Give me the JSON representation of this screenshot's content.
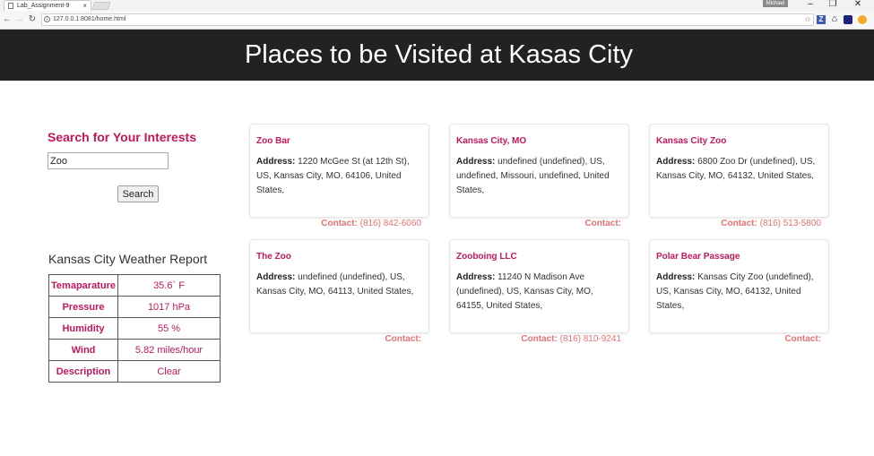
{
  "browser": {
    "tab_title": "Lab_Assignment-9",
    "tab_close": "×",
    "url": "127.0.0.1:8081/home.html",
    "profile_name": "Michael"
  },
  "header": {
    "title": "Places to be Visited at Kasas City"
  },
  "search": {
    "title": "Search for Your Interests",
    "value": "Zoo",
    "button_label": "Search"
  },
  "weather": {
    "title": "Kansas City Weather Report",
    "rows": [
      {
        "label": "Temaparature",
        "value": "35.6` F"
      },
      {
        "label": "Pressure",
        "value": "1017 hPa"
      },
      {
        "label": "Humidity",
        "value": "55 %"
      },
      {
        "label": "Wind",
        "value": "5.82 miles/hour"
      },
      {
        "label": "Description",
        "value": "Clear"
      }
    ]
  },
  "address_label": "Address:",
  "contact_label": "Contact:",
  "places": [
    {
      "name": "Zoo Bar",
      "address": "1220 McGee St (at 12th St), US, Kansas City, MO, 64106, United States,",
      "phone": "(816) 842-6060"
    },
    {
      "name": "Kansas City, MO",
      "address": "undefined (undefined), US, undefined, Missouri, undefined, United States,",
      "phone": ""
    },
    {
      "name": "Kansas City Zoo",
      "address": "6800 Zoo Dr (undefined), US, Kansas City, MO, 64132, United States,",
      "phone": "(816) 513-5800"
    },
    {
      "name": "The Zoo",
      "address": "undefined (undefined), US, Kansas City, MO, 64113, United States,",
      "phone": ""
    },
    {
      "name": "Zooboing LLC",
      "address": "11240 N Madison Ave (undefined), US, Kansas City, MO, 64155, United States,",
      "phone": "(816) 810-9241"
    },
    {
      "name": "Polar Bear Passage",
      "address": "Kansas City Zoo (undefined), US, Kansas City, MO, 64132, United States,",
      "phone": ""
    }
  ],
  "colors": {
    "accent": "#c2185b",
    "contact": "#e57373",
    "header_bg": "#222222"
  }
}
